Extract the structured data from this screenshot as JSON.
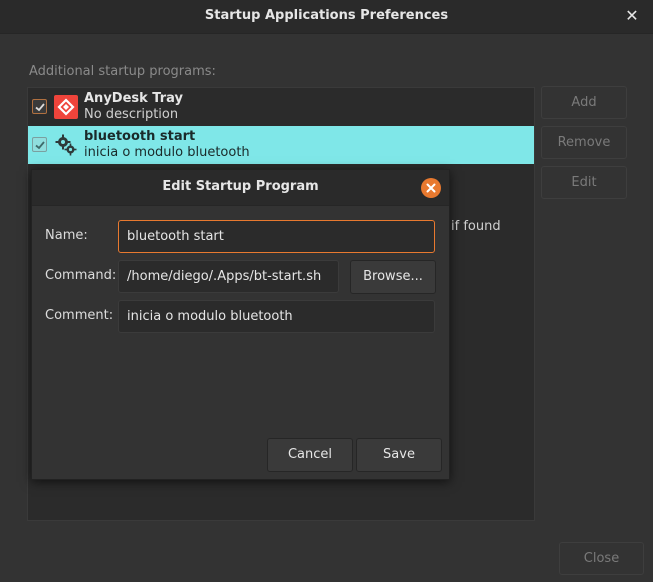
{
  "window": {
    "title": "Startup Applications Preferences",
    "close_glyph": "✕"
  },
  "main": {
    "section_label": "Additional startup programs:",
    "programs": [
      {
        "name": "AnyDesk Tray",
        "description": "No description",
        "checked": true,
        "icon": "anydesk-icon",
        "selected": false
      },
      {
        "name": "bluetooth start",
        "description": "inicia o modulo bluetooth",
        "checked": true,
        "icon": "gears-icon",
        "selected": true
      }
    ],
    "partial_text": "if found",
    "buttons": {
      "add": "Add",
      "remove": "Remove",
      "edit": "Edit"
    },
    "close_button": "Close"
  },
  "dialog": {
    "title": "Edit Startup Program",
    "close_icon": "close-icon",
    "name_label": "Name:",
    "name_value": "bluetooth start",
    "command_label": "Command:",
    "command_value": "/home/diego/.Apps/bt-start.sh",
    "browse_button": "Browse...",
    "comment_label": "Comment:",
    "comment_value": "inicia o modulo bluetooth",
    "cancel_button": "Cancel",
    "save_button": "Save"
  },
  "colors": {
    "accent": "#e8792f",
    "selection": "#7fe7e8",
    "anydesk_red": "#ef443b"
  }
}
